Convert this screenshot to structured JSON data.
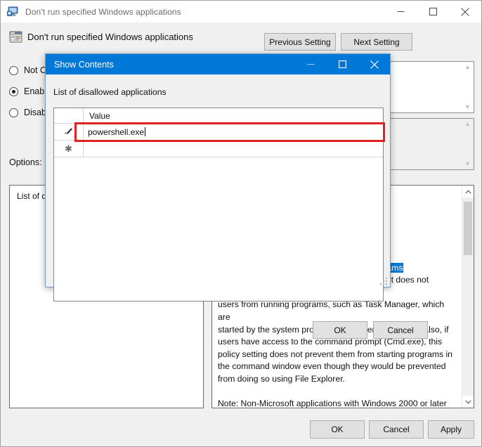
{
  "main_window": {
    "titlebar": {
      "icon": "monitor-policy-icon",
      "title": "Don't run specified Windows applications",
      "minimize": "–",
      "maximize": "☐",
      "close": "✕"
    },
    "header": {
      "icon": "policy-setting-icon",
      "policy_title": "Don't run specified Windows applications",
      "previous_setting_label": "Previous Setting",
      "next_setting_label": "Next Setting"
    },
    "states": [
      {
        "label": "Not Configured",
        "selected": false
      },
      {
        "label": "Enabled",
        "selected": true
      },
      {
        "label": "Disabled",
        "selected": false
      }
    ],
    "options_label": "Options:",
    "options_panel": {
      "setting_label": "List of disallowed applications"
    },
    "help_panel": {
      "text_visible": "you specify in this\n\nun programs that\n\nigure it, users can\n\npolicy setting does not prevent running programs\nthat are started by the File Explorer process. It does not prevent\nusers from running programs, such as Task Manager, which are\nstarted by the system process or by other processes.  Also, if\nusers have access to the command prompt (Cmd.exe), this\npolicy setting does not prevent them from starting programs in\nthe command window even though they would be prevented\nfrom doing so using File Explorer.\n\nNote: Non-Microsoft applications with Windows 2000 or later\ncertification are required to comply with this policy setting.\nNote: To create a list of allowed applications, click Show.  In the\n",
      "scroll_up": "⌃",
      "scroll_down": "⌄"
    },
    "footer": {
      "ok_label": "OK",
      "cancel_label": "Cancel",
      "apply_label": "Apply"
    }
  },
  "dialog": {
    "titlebar": {
      "title": "Show Contents",
      "minimize": "–",
      "maximize": "☐",
      "close": "✕"
    },
    "sublabel": "List of disallowed applications",
    "grid": {
      "columns": [
        "",
        "Value"
      ],
      "rows": [
        {
          "row_indicator": "edit-pencil-icon",
          "value": "powershell.exe",
          "editing": true
        },
        {
          "row_indicator": "new-row-asterisk-icon",
          "value": "",
          "editing": false
        }
      ]
    },
    "ok_label": "OK",
    "cancel_label": "Cancel"
  },
  "annotation": {
    "highlight_color": "#dd2222"
  },
  "colors": {
    "dialog_titlebar": "#0078d7",
    "window_chrome": "#f0f0f0",
    "button_face": "#e1e1e1",
    "selection_blue": "#0078d7"
  }
}
